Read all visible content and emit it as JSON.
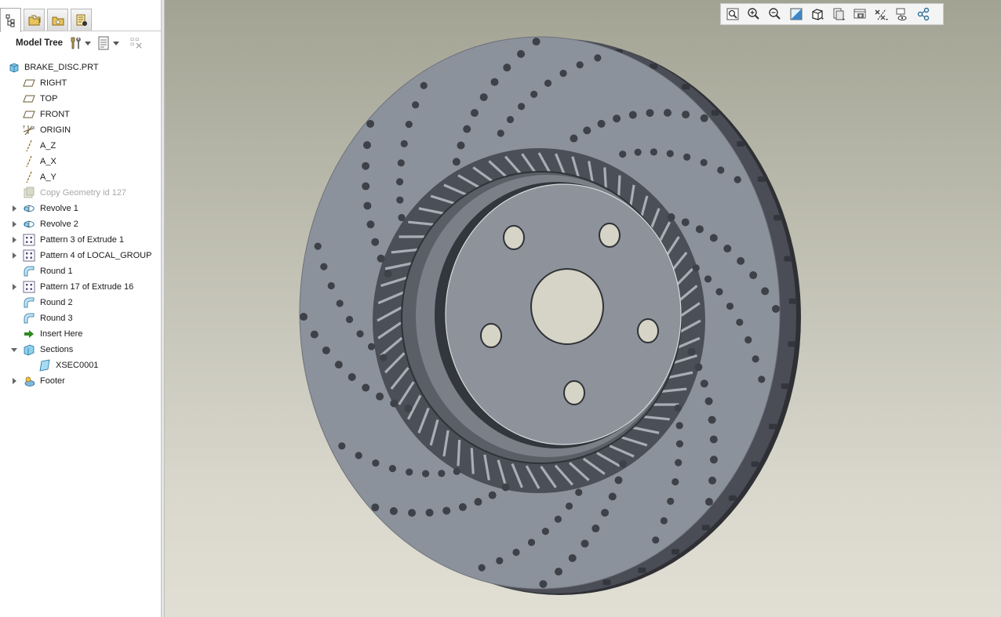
{
  "panel_tabs": [
    {
      "name": "model-tree-tab-icon"
    },
    {
      "name": "folder-browser-tab-icon"
    },
    {
      "name": "favorites-tab-icon"
    },
    {
      "name": "history-tab-icon"
    }
  ],
  "tree_toolbar": {
    "title": "Model Tree",
    "settings_icon": "tools-icon",
    "show_icon": "tree-columns-icon",
    "filter_icon": "tree-filter-icon"
  },
  "tree": [
    {
      "label": "BRAKE_DISC.PRT",
      "icon": "part-icon",
      "indent": 0,
      "toggle": "none",
      "disabled": false
    },
    {
      "label": "RIGHT",
      "icon": "datum-plane-icon",
      "indent": 1,
      "toggle": "none",
      "disabled": false
    },
    {
      "label": "TOP",
      "icon": "datum-plane-icon",
      "indent": 1,
      "toggle": "none",
      "disabled": false
    },
    {
      "label": "FRONT",
      "icon": "datum-plane-icon",
      "indent": 1,
      "toggle": "none",
      "disabled": false
    },
    {
      "label": "ORIGIN",
      "icon": "coordinate-system-icon",
      "indent": 1,
      "toggle": "none",
      "disabled": false
    },
    {
      "label": "A_Z",
      "icon": "datum-axis-icon",
      "indent": 1,
      "toggle": "none",
      "disabled": false
    },
    {
      "label": "A_X",
      "icon": "datum-axis-icon",
      "indent": 1,
      "toggle": "none",
      "disabled": false
    },
    {
      "label": "A_Y",
      "icon": "datum-axis-icon",
      "indent": 1,
      "toggle": "none",
      "disabled": false
    },
    {
      "label": "Copy Geometry id 127",
      "icon": "copy-geometry-icon",
      "indent": 1,
      "toggle": "none",
      "disabled": true
    },
    {
      "label": "Revolve 1",
      "icon": "revolve-icon",
      "indent": 1,
      "toggle": "collapsed",
      "disabled": false
    },
    {
      "label": "Revolve 2",
      "icon": "revolve-icon",
      "indent": 1,
      "toggle": "collapsed",
      "disabled": false
    },
    {
      "label": "Pattern 3 of Extrude 1",
      "icon": "pattern-icon",
      "indent": 1,
      "toggle": "collapsed",
      "disabled": false
    },
    {
      "label": "Pattern 4 of LOCAL_GROUP",
      "icon": "pattern-icon",
      "indent": 1,
      "toggle": "collapsed",
      "disabled": false
    },
    {
      "label": "Round 1",
      "icon": "round-icon",
      "indent": 1,
      "toggle": "none",
      "disabled": false
    },
    {
      "label": "Pattern 17 of Extrude 16",
      "icon": "pattern-icon",
      "indent": 1,
      "toggle": "collapsed",
      "disabled": false
    },
    {
      "label": "Round 2",
      "icon": "round-icon",
      "indent": 1,
      "toggle": "none",
      "disabled": false
    },
    {
      "label": "Round 3",
      "icon": "round-icon",
      "indent": 1,
      "toggle": "none",
      "disabled": false
    },
    {
      "label": "Insert Here",
      "icon": "insert-arrow-icon",
      "indent": 1,
      "toggle": "none",
      "disabled": false
    },
    {
      "label": "Sections",
      "icon": "sections-icon",
      "indent": 1,
      "toggle": "expanded",
      "disabled": false
    },
    {
      "label": "XSEC0001",
      "icon": "xsection-icon",
      "indent": 2,
      "toggle": "none",
      "disabled": false
    },
    {
      "label": "Footer",
      "icon": "footer-icon",
      "indent": 1,
      "toggle": "collapsed",
      "disabled": false
    }
  ],
  "view_toolbar": [
    {
      "name": "refit-icon"
    },
    {
      "name": "zoom-in-icon"
    },
    {
      "name": "zoom-out-icon"
    },
    {
      "name": "repaint-icon"
    },
    {
      "name": "display-style-icon"
    },
    {
      "name": "saved-views-icon"
    },
    {
      "name": "view-manager-icon"
    },
    {
      "name": "datum-display-icon"
    },
    {
      "name": "annotation-display-icon"
    },
    {
      "name": "spin-center-icon"
    }
  ],
  "colors": {
    "disc_face": "#8c929c",
    "disc_dark": "#3e4148",
    "hole_fill": "#d6d4c6",
    "disabled_text": "#a8a8a8",
    "insert_arrow": "#2e8b1e"
  }
}
